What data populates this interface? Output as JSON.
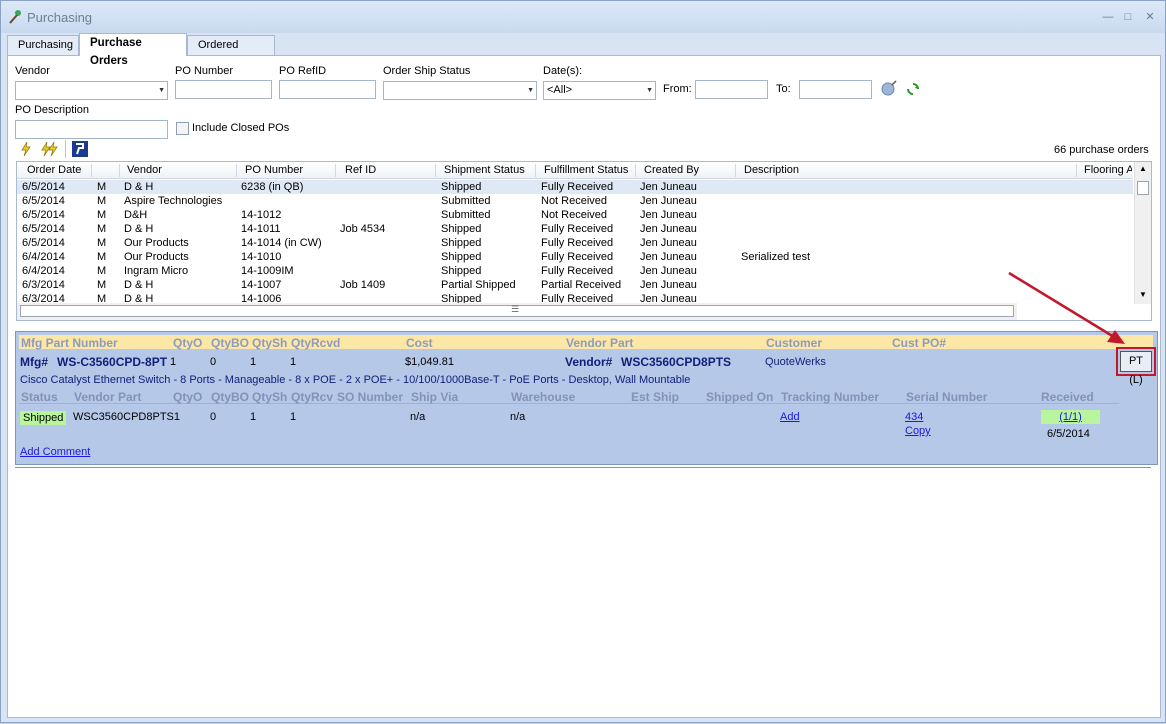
{
  "window": {
    "title": "Purchasing"
  },
  "tabs": [
    {
      "label": "Purchasing"
    },
    {
      "label": "Purchase Orders"
    },
    {
      "label": "Ordered Items"
    }
  ],
  "filters": {
    "vendor_label": "Vendor",
    "po_number_label": "PO Number",
    "po_refid_label": "PO RefID",
    "order_ship_status_label": "Order Ship Status",
    "dates_label": "Date(s):",
    "dates_value": "<All>",
    "from_label": "From:",
    "to_label": "To:",
    "po_description_label": "PO Description",
    "include_closed_label": "Include Closed POs"
  },
  "count_text": "66 purchase orders",
  "grid": {
    "columns": [
      "Order Date",
      "Vendor",
      "PO Number",
      "Ref ID",
      "Shipment Status",
      "Fulfillment Status",
      "Created By",
      "Description",
      "Flooring A"
    ],
    "rows": [
      {
        "date": "6/5/2014",
        "m": "M",
        "vendor": "D & H",
        "po": "6238 (in QB)",
        "ref": "",
        "ship": "Shipped",
        "fulfill": "Fully Received",
        "by": "Jen Juneau",
        "desc": ""
      },
      {
        "date": "6/5/2014",
        "m": "M",
        "vendor": "Aspire Technologies",
        "po": "",
        "ref": "",
        "ship": "Submitted",
        "fulfill": "Not Received",
        "by": "Jen Juneau",
        "desc": ""
      },
      {
        "date": "6/5/2014",
        "m": "M",
        "vendor": "D&H",
        "po": "14-1012",
        "ref": "",
        "ship": "Submitted",
        "fulfill": "Not Received",
        "by": "Jen Juneau",
        "desc": ""
      },
      {
        "date": "6/5/2014",
        "m": "M",
        "vendor": "D & H",
        "po": "14-1011",
        "ref": "Job 4534",
        "ship": "Shipped",
        "fulfill": "Fully Received",
        "by": "Jen Juneau",
        "desc": ""
      },
      {
        "date": "6/5/2014",
        "m": "M",
        "vendor": "Our Products",
        "po": "14-1014 (in CW)",
        "ref": "",
        "ship": "Shipped",
        "fulfill": "Fully Received",
        "by": "Jen Juneau",
        "desc": ""
      },
      {
        "date": "6/4/2014",
        "m": "M",
        "vendor": "Our Products",
        "po": "14-1010",
        "ref": "",
        "ship": "Shipped",
        "fulfill": "Fully Received",
        "by": "Jen Juneau",
        "desc": "Serialized test"
      },
      {
        "date": "6/4/2014",
        "m": "M",
        "vendor": "Ingram Micro",
        "po": "14-1009IM",
        "ref": "",
        "ship": "Shipped",
        "fulfill": "Fully Received",
        "by": "Jen Juneau",
        "desc": ""
      },
      {
        "date": "6/3/2014",
        "m": "M",
        "vendor": "D & H",
        "po": "14-1007",
        "ref": "Job 1409",
        "ship": "Partial Shipped",
        "fulfill": "Partial Received",
        "by": "Jen Juneau",
        "desc": ""
      },
      {
        "date": "6/3/2014",
        "m": "M",
        "vendor": "D & H",
        "po": "14-1006",
        "ref": "",
        "ship": "Shipped",
        "fulfill": "Fully Received",
        "by": "Jen Juneau",
        "desc": ""
      }
    ]
  },
  "detail": {
    "headers": [
      "Mfg Part Number",
      "QtyO",
      "QtyBO",
      "QtySh",
      "QtyRcvd",
      "Cost",
      "Vendor Part",
      "Customer",
      "Cust PO#"
    ],
    "mfg_label": "Mfg#",
    "mfg_value": "WS-C3560CPD-8PT",
    "qtyo": "1",
    "qtybo": "0",
    "qtysh": "1",
    "qtyrcvd": "1",
    "cost": "$1,049.81",
    "vendor_label": "Vendor#",
    "vendor_value": "WSC3560CPD8PTS",
    "customer": "QuoteWerks",
    "pt_label": "PT (L)",
    "description": "Cisco Catalyst Ethernet Switch - 8 Ports - Manageable - 8 x POE - 2 x POE+ - 10/100/1000Base-T - PoE Ports - Desktop, Wall Mountable",
    "sub_headers": [
      "Status",
      "Vendor Part",
      "QtyO",
      "QtyBO",
      "QtySh",
      "QtyRcv",
      "SO Number",
      "Ship Via",
      "Warehouse",
      "Est Ship",
      "Shipped On",
      "Tracking Number",
      "Serial Number",
      "Received"
    ],
    "ship": {
      "status": "Shipped",
      "vendor_part": "WSC3560CPD8PTS1",
      "qtybo": "0",
      "qtysh": "1",
      "qtyrcv": "1",
      "ship_via": "n/a",
      "warehouse": "n/a",
      "tracking_link": "Add",
      "serial_link": "434",
      "copy_link": "Copy",
      "received_badge": "(1/1)",
      "received_date": "6/5/2014"
    },
    "add_comment": "Add Comment"
  },
  "colors": {
    "annotation_red": "#c3172b",
    "detail_bg": "#b6c8e8",
    "header_yellow": "#fce7a6",
    "received_green": "#b9f59d"
  }
}
